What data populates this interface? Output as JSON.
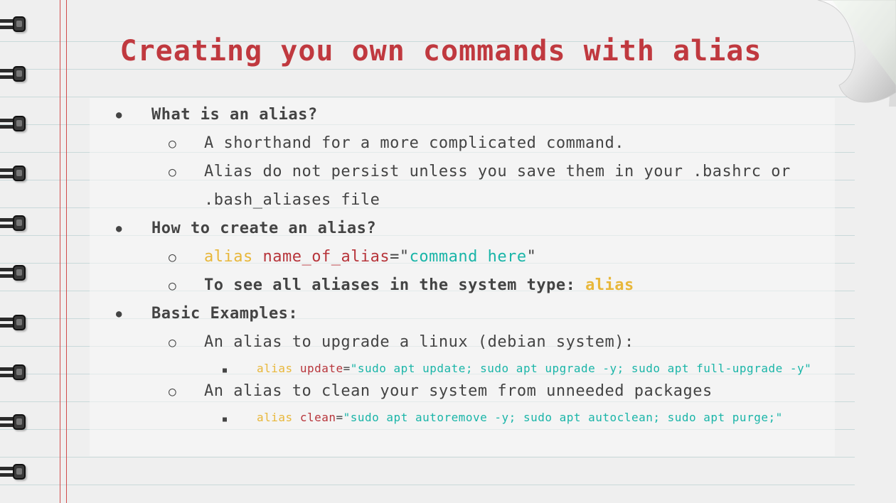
{
  "title": "Creating you own commands with alias",
  "bullets": {
    "disc": "●",
    "circle": "○",
    "square": "■"
  },
  "sections": {
    "what": {
      "heading": "What is an alias?",
      "item1": "A shorthand for a more complicated command.",
      "item2_line1": "Alias do not persist unless you save them in your .bashrc or",
      "item2_line2": ".bash_aliases file"
    },
    "how": {
      "heading": "How to create an alias?",
      "syntax": {
        "keyword": "alias",
        "name": "name_of_alias",
        "eq": "=",
        "quote_open": "\"",
        "value": "command here",
        "quote_close": "\""
      },
      "see_all_text": "To see all aliases in the system type: ",
      "see_all_cmd": "alias"
    },
    "examples": {
      "heading": "Basic Examples:",
      "upgrade_desc": "An alias to upgrade a linux (debian system):",
      "upgrade_code": {
        "keyword": "alias",
        "name": "update",
        "eq": "=",
        "value": "\"sudo apt update; sudo apt upgrade -y; sudo apt full-upgrade -y\""
      },
      "clean_desc": "An alias to clean your system from unneeded packages",
      "clean_code": {
        "keyword": "alias",
        "name": "clean",
        "eq": "=",
        "value": "\"sudo apt autoremove -y; sudo apt autoclean; sudo apt purge;\""
      }
    }
  },
  "colors": {
    "title": "#c0393f",
    "keyword": "#e8b73a",
    "variable": "#b7353b",
    "string": "#1ab5a8",
    "text": "#444444",
    "rule": "#c9d9da",
    "margin": "#d24b4b"
  }
}
